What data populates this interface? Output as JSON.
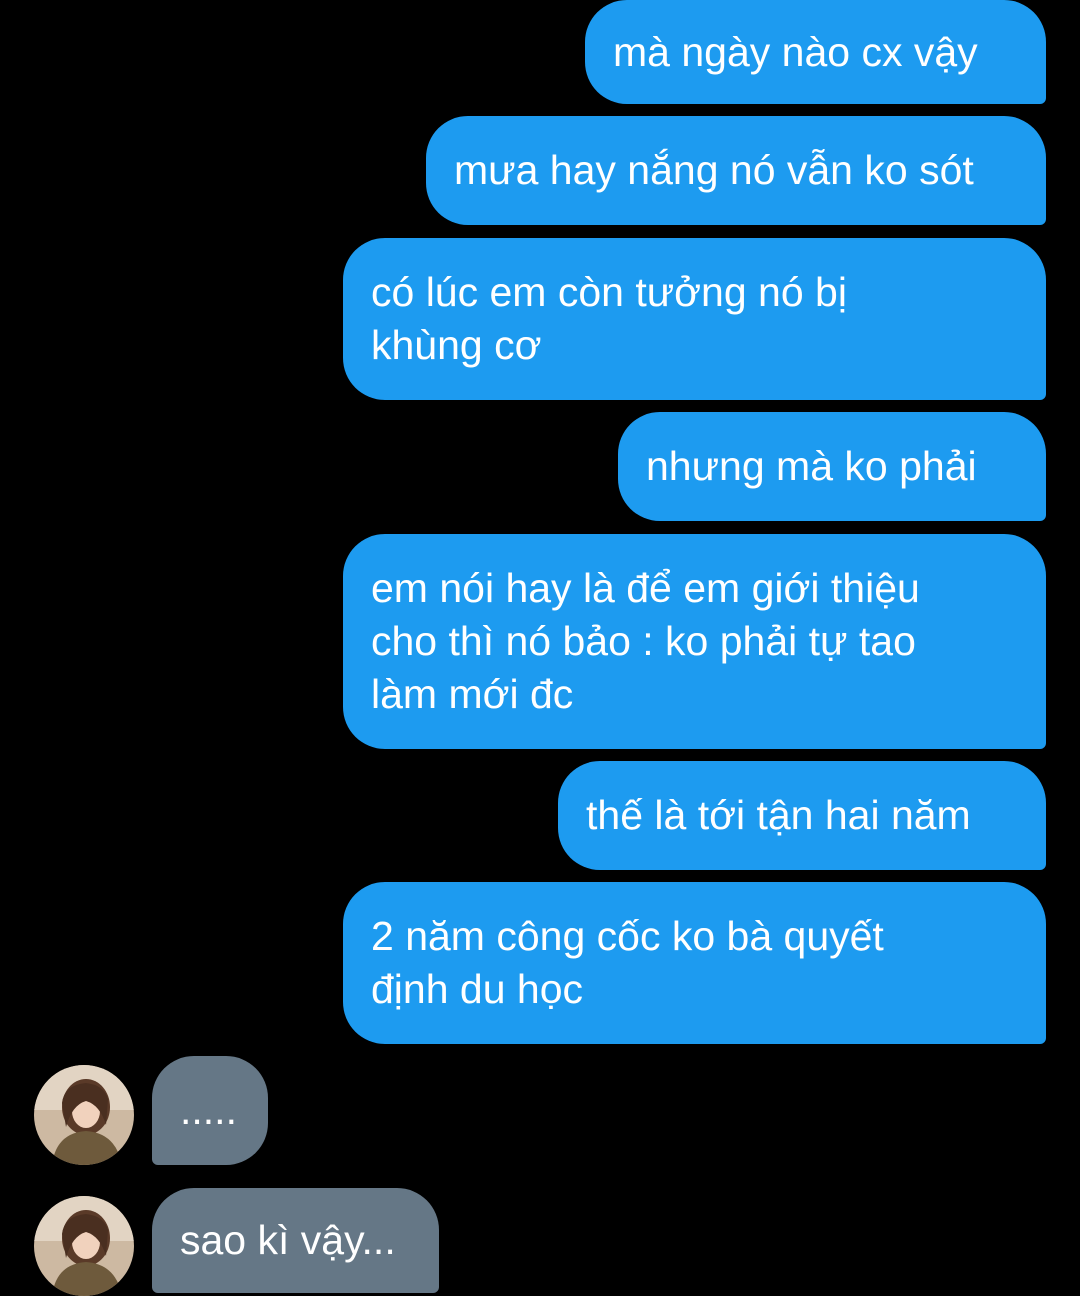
{
  "conversation": {
    "sent_messages": [
      "mà ngày nào cx vậy",
      "mưa hay nắng nó vẫn ko sót",
      "có lúc em còn tưởng nó bị\nkhùng cơ",
      "nhưng mà ko phải",
      "em nói hay là để em giới thiệu\ncho thì nó bảo : ko phải tự tao\nlàm mới đc",
      "thế là tới tận hai năm",
      "2 năm công cốc ko bà quyết\nđịnh du học"
    ],
    "received_messages": [
      ".....",
      "sao kì vậy..."
    ]
  },
  "colors": {
    "sent_bubble": "#1d9bf0",
    "received_bubble": "#657786",
    "background": "#000000",
    "text": "#ffffff"
  },
  "icons": {
    "avatar": "contact-avatar-photo"
  }
}
